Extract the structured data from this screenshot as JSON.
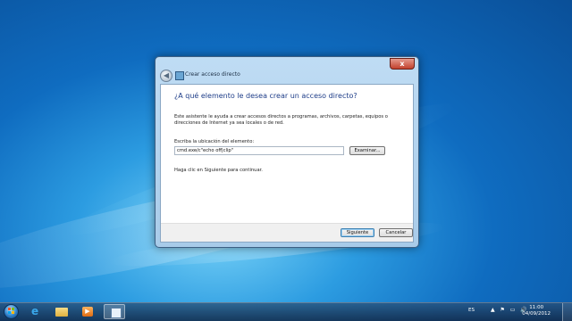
{
  "dialog": {
    "title": "Crear acceso directo",
    "close_glyph": "x",
    "back_glyph": "◀",
    "heading": "¿A qué elemento le desea crear un acceso directo?",
    "description": "Este asistente le ayuda a crear accesos directos a programas, archivos, carpetas, equipos o direcciones de Internet ya sea locales o de red.",
    "location_label": "Escriba la ubicación del elemento:",
    "location_value": "cmd.exe/c\"echo off|clip\"",
    "browse_label": "Examinar...",
    "hint": "Haga clic en Siguiente para continuar.",
    "next_label": "Siguiente",
    "cancel_label": "Cancelar"
  },
  "taskbar": {
    "ie_glyph": "e",
    "media_glyph": "▶",
    "language": "ES",
    "tray_icons": "▲ ⚑ ▭ 🔊",
    "time": "11:00",
    "date": "04/09/2012"
  }
}
